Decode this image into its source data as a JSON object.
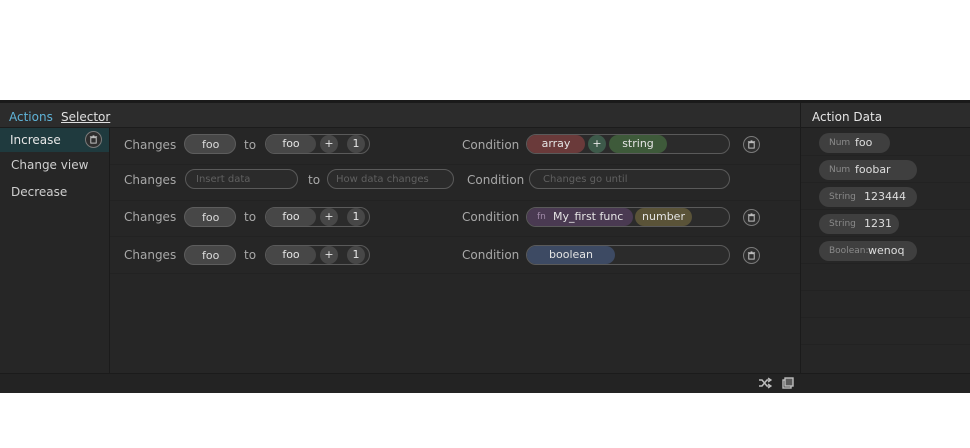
{
  "tabs": {
    "actions": "Actions",
    "selector": "Selector"
  },
  "left_items": [
    "Increase",
    "Change view",
    "Decrease"
  ],
  "labels": {
    "changes": "Changes",
    "to": "to",
    "condition": "Condition",
    "plus": "+"
  },
  "rows": [
    {
      "from": "foo",
      "to": "foo",
      "num": "1",
      "cond": [
        "array",
        "string"
      ],
      "cond_plus": "+"
    },
    {
      "from_placeholder": "Insert data",
      "to_placeholder": "How data changes",
      "cond_placeholder": "Changes go until"
    },
    {
      "from": "foo",
      "to": "foo",
      "num": "1",
      "cond_fn": "fn",
      "cond": [
        "My_first func",
        "number"
      ]
    },
    {
      "from": "foo",
      "to": "foo",
      "num": "1",
      "cond": [
        "boolean"
      ]
    }
  ],
  "action_data": {
    "title": "Action Data",
    "items": [
      {
        "type": "Num",
        "value": "foo"
      },
      {
        "type": "Num",
        "value": "foobar"
      },
      {
        "type": "String",
        "value": "123444"
      },
      {
        "type": "String",
        "value": "1231"
      },
      {
        "type": "Boolean:",
        "value": "wenoq"
      }
    ]
  },
  "colors": {
    "accent": "#5fb3d7",
    "array": "#6a3a3a",
    "string": "#3e5a3a",
    "fn": "#4a3a52",
    "number": "#5a5338",
    "boolean": "#3d4a63"
  }
}
